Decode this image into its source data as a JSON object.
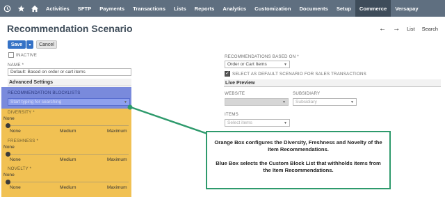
{
  "nav": {
    "items": [
      "Activities",
      "SFTP",
      "Payments",
      "Transactions",
      "Lists",
      "Reports",
      "Analytics",
      "Customization",
      "Documents",
      "Setup",
      "Commerce",
      "Versapay"
    ],
    "active": "Commerce",
    "icons": [
      "recent-records-icon",
      "star-icon",
      "home-icon"
    ]
  },
  "page": {
    "title": "Recommendation Scenario",
    "tools": {
      "back": "←",
      "forward": "→",
      "list": "List",
      "search": "Search"
    }
  },
  "buttons": {
    "save": "Save",
    "dropdown": "▾",
    "cancel": "Cancel"
  },
  "form": {
    "inactive_label": "INACTIVE",
    "name_label": "NAME *",
    "name_value": "Default: Based on order or cart items",
    "advanced_settings": "Advanced Settings",
    "blocklists_label": "RECOMMENDATION BLOCKLISTS",
    "blocklists_placeholder": "Start typing for searching",
    "diversity_label": "DIVERSITY *",
    "freshness_label": "FRESHNESS *",
    "novelty_label": "NOVELTY *",
    "slider_value": "None",
    "slider_ticks": [
      "None",
      "Medium",
      "Maximum"
    ],
    "slider_level": 0
  },
  "right": {
    "based_on_label": "RECOMMENDATIONS BASED ON *",
    "based_on_value": "Order or Cart Items",
    "default_scenario_label": "SELECT AS DEFAULT SCENARIO FOR SALES TRANSACTIONS",
    "default_scenario_checked": true,
    "live_preview": "Live Preview",
    "website_label": "WEBSITE",
    "subsidiary_label": "SUBSIDIARY",
    "subsidiary_placeholder": "Subsidiary",
    "items_label": "ITEMS",
    "items_placeholder": "Select items"
  },
  "callout": {
    "line1": "Orange Box configures the Diversity, Freshness and Novelty of the Item Recommendations.",
    "line2": "Blue Box selects the Custom Block List that withholds items from the Item Recommendations."
  },
  "colors": {
    "nav": "#5f6f80",
    "active_nav": "#3e4c5a",
    "orange": "#f1c153",
    "blue": "#6f86e8",
    "callout_border": "#2e9a6c",
    "save": "#3572c6"
  }
}
